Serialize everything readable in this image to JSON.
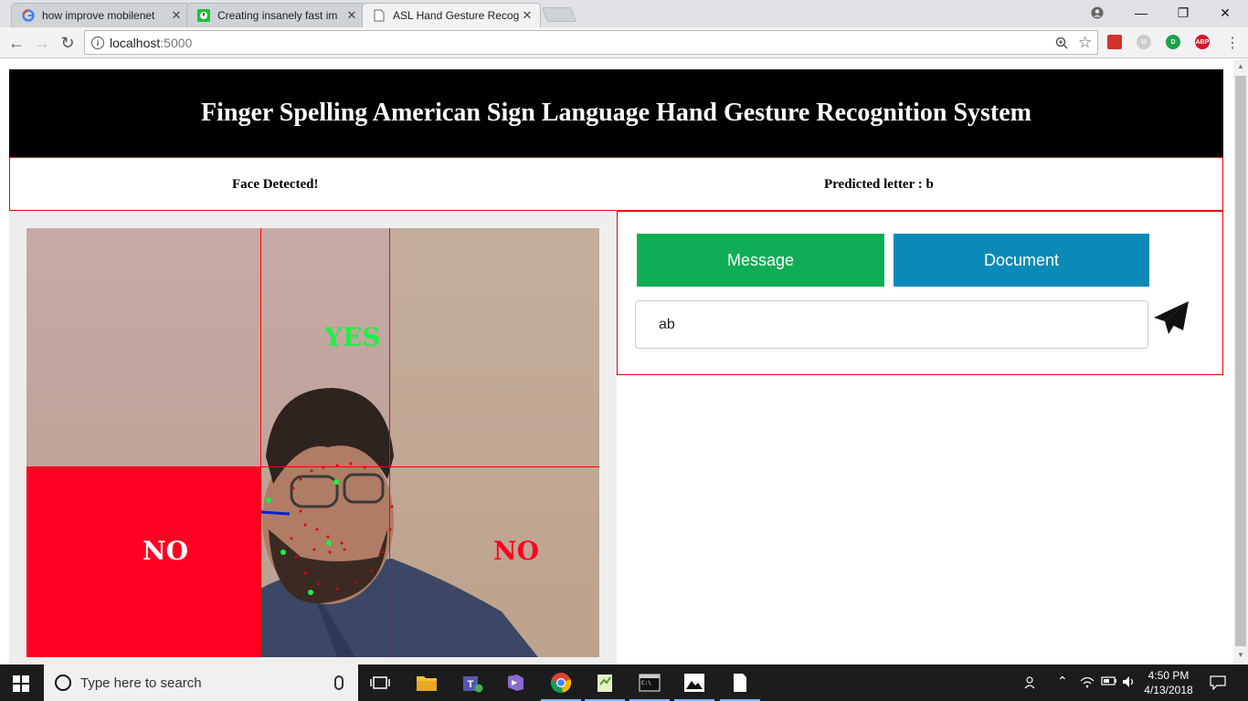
{
  "browser": {
    "tabs": [
      {
        "title": "how improve mobilenet",
        "favicon": "google-icon",
        "active": false
      },
      {
        "title": "Creating insanely fast im",
        "favicon": "green-clock-icon",
        "active": false
      },
      {
        "title": "ASL Hand Gesture Recog",
        "favicon": "page-icon",
        "active": true
      }
    ],
    "url": {
      "host": "localhost",
      "port": ":5000"
    }
  },
  "page": {
    "header_title": "Finger Spelling American Sign Language Hand Gesture Recognition System",
    "status": {
      "face": "Face Detected!",
      "prediction": "Predicted letter : b"
    },
    "camera": {
      "yes_label": "YES",
      "no_left_label": "NO",
      "no_right_label": "NO"
    },
    "actions": {
      "message_label": "Message",
      "document_label": "Document"
    },
    "input_value": "ab"
  },
  "taskbar": {
    "search_placeholder": "Type here to search",
    "time": "4:50 PM",
    "date": "4/13/2018"
  },
  "colors": {
    "message_button": "#0fad55",
    "document_button": "#0a8ab8",
    "no_zone": "#ff0022",
    "yes_text": "#22ee44",
    "panel_border": "#ee0000"
  }
}
